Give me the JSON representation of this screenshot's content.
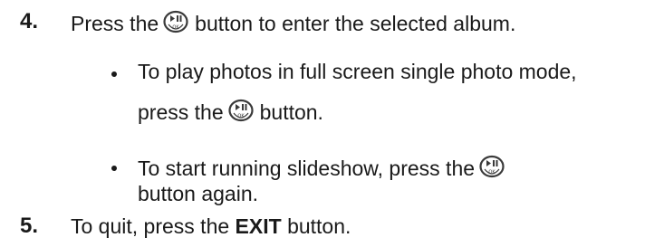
{
  "steps": [
    {
      "number": "4.",
      "text_before_icon": "Press the",
      "icon": "play-pause-ok-icon",
      "text_after_icon": "button to enter the selected album.",
      "bullets": [
        {
          "line1": "To play photos in full screen single photo mode,",
          "line2_before_icon": "press the",
          "icon": "play-pause-ok-icon",
          "line2_after_icon": "button."
        },
        {
          "line1_before_icon": "To start running slideshow, press the",
          "icon": "play-pause-ok-icon",
          "line2": "button again."
        }
      ]
    },
    {
      "number": "5.",
      "text_before_bold": "To quit, press the",
      "bold": "EXIT",
      "text_after_bold": "button."
    }
  ],
  "colors": {
    "text": "#1a1a1a",
    "icon_stroke": "#3a3a3a"
  }
}
